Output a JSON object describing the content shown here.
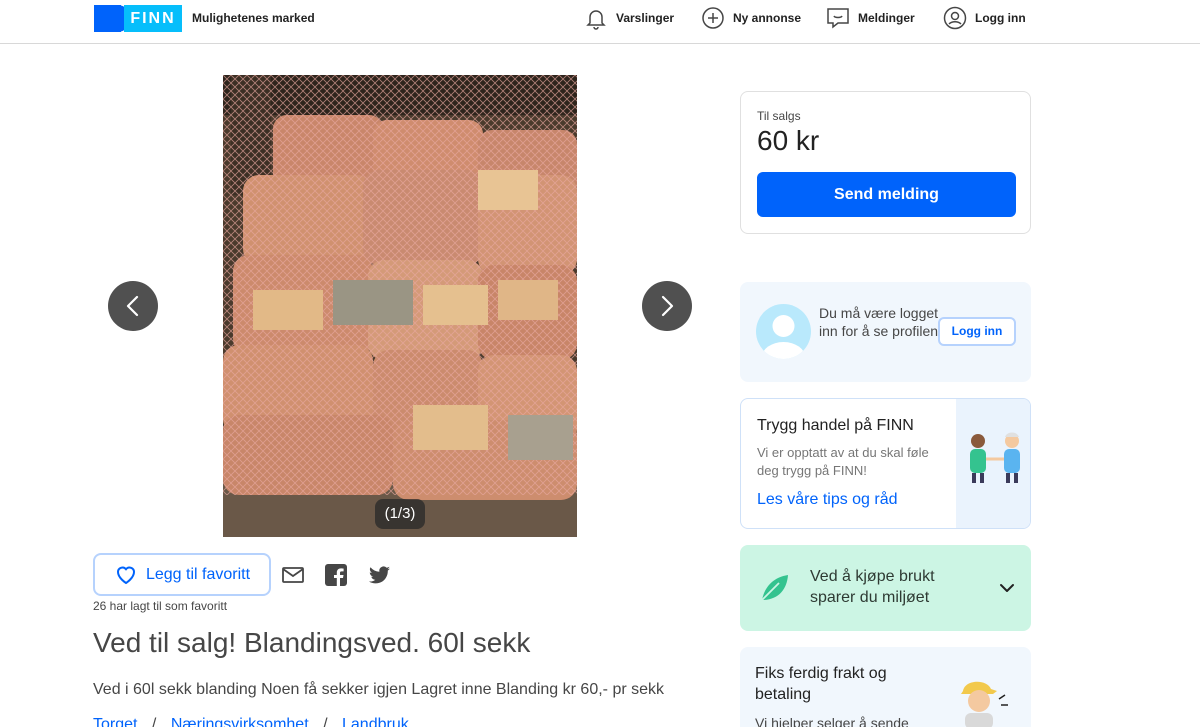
{
  "header": {
    "logo_text": "FINN",
    "tagline": "Mulighetenes marked",
    "nav": {
      "alerts": "Varslinger",
      "new_ad": "Ny annonse",
      "messages": "Meldinger",
      "login": "Logg inn"
    }
  },
  "gallery": {
    "counter": "(1/3)",
    "current_image": 1,
    "total_images": 3
  },
  "actions": {
    "favorite_label": "Legg til favoritt",
    "favorite_count_text": "26 har lagt til som favoritt"
  },
  "listing": {
    "title": "Ved til salg! Blandingsved. 60l sekk",
    "description": "Ved i 60l sekk blanding Noen få sekker igjen Lagret inne Blanding kr 60,- pr sekk",
    "breadcrumbs": [
      "Torget",
      "Næringsvirksomhet",
      "Landbruk"
    ]
  },
  "price_card": {
    "label": "Til salgs",
    "price": "60 kr",
    "button": "Send melding"
  },
  "profile_card": {
    "text": "Du må være logget inn for å se profilen",
    "button": "Logg inn"
  },
  "safe_trade": {
    "title": "Trygg handel på FINN",
    "text": "Vi er opptatt av at du skal føle deg trygg på FINN!",
    "link": "Les våre tips og råd"
  },
  "eco": {
    "text": "Ved å kjøpe brukt sparer du miljøet"
  },
  "shipping": {
    "title": "Fiks ferdig frakt og betaling",
    "text": "Vi hjelper selger å sende"
  },
  "colors": {
    "brand_blue": "#0063fb",
    "brand_light_blue": "#06befb",
    "eco_green": "#ccf5e4",
    "info_bg": "#f1f7fd"
  }
}
